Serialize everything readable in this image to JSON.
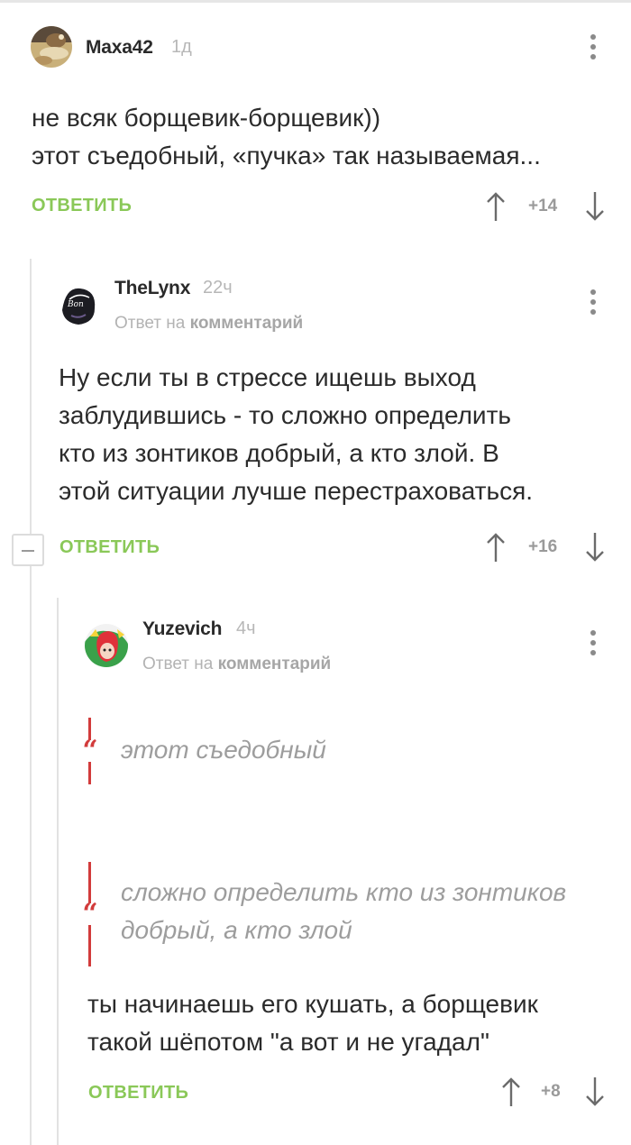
{
  "comments": [
    {
      "username": "Maxa42",
      "time": "1д",
      "text_lines": [
        "не всяк борщевик-борщевик))",
        "этот съедобный, «пучка» так называемая..."
      ],
      "reply_label": "ОТВЕТИТЬ",
      "score": "+14"
    },
    {
      "username": "TheLynx",
      "time": "22ч",
      "reply_to_prefix": "Ответ на",
      "reply_to_link": "комментарий",
      "text_lines": [
        "Ну если ты в стрессе ищешь выход",
        "заблудившись - то сложно определить",
        "кто из зонтиков добрый, а кто злой. В",
        "этой ситуации лучше перестраховаться."
      ],
      "reply_label": "ОТВЕТИТЬ",
      "score": "+16"
    },
    {
      "username": "Yuzevich",
      "time": "4ч",
      "reply_to_prefix": "Ответ на",
      "reply_to_link": "комментарий",
      "quotes": [
        {
          "mark": "“",
          "lines": [
            "этот съедобный"
          ]
        },
        {
          "mark": "“",
          "lines": [
            "сложно определить кто из зонтиков",
            "добрый, а кто злой"
          ]
        }
      ],
      "text_lines": [
        "ты начинаешь его кушать, а борщевик",
        "такой шёпотом \"а вот и не угадал\""
      ],
      "reply_label": "ОТВЕТИТЬ",
      "score": "+8"
    }
  ],
  "colors": {
    "reply_green": "#8ac858",
    "quote_red": "#d23b3b",
    "muted_gray": "#b3b3b3",
    "thread_line": "#e2e2e2"
  },
  "icons": {
    "menu": "kebab-menu-icon",
    "upvote": "arrow-up-icon",
    "downvote": "arrow-down-icon",
    "collapse": "minus-icon",
    "quote": "quote-icon"
  }
}
